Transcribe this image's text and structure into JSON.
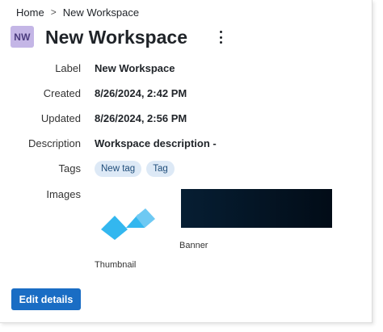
{
  "breadcrumb": {
    "home": "Home",
    "separator": ">",
    "current": "New Workspace"
  },
  "header": {
    "avatar_initials": "NW",
    "title": "New Workspace",
    "avatar_color": "#c4b6e6"
  },
  "details": {
    "label": {
      "name": "Label",
      "value": "New Workspace"
    },
    "created": {
      "name": "Created",
      "value": "8/26/2024, 2:42 PM"
    },
    "updated": {
      "name": "Updated",
      "value": "8/26/2024, 2:56 PM"
    },
    "description": {
      "name": "Description",
      "value": "Workspace description -"
    },
    "tags": {
      "name": "Tags",
      "items": [
        "New tag",
        "Tag"
      ]
    }
  },
  "images": {
    "name": "Images",
    "thumbnail_caption": "Thumbnail",
    "banner_caption": "Banner"
  },
  "actions": {
    "edit_label": "Edit details"
  },
  "colors": {
    "primary": "#1a6dc4",
    "tag_bg": "#dde9f6",
    "thumbnail_light": "#6ec9f3",
    "thumbnail_dark": "#33b7ef"
  }
}
